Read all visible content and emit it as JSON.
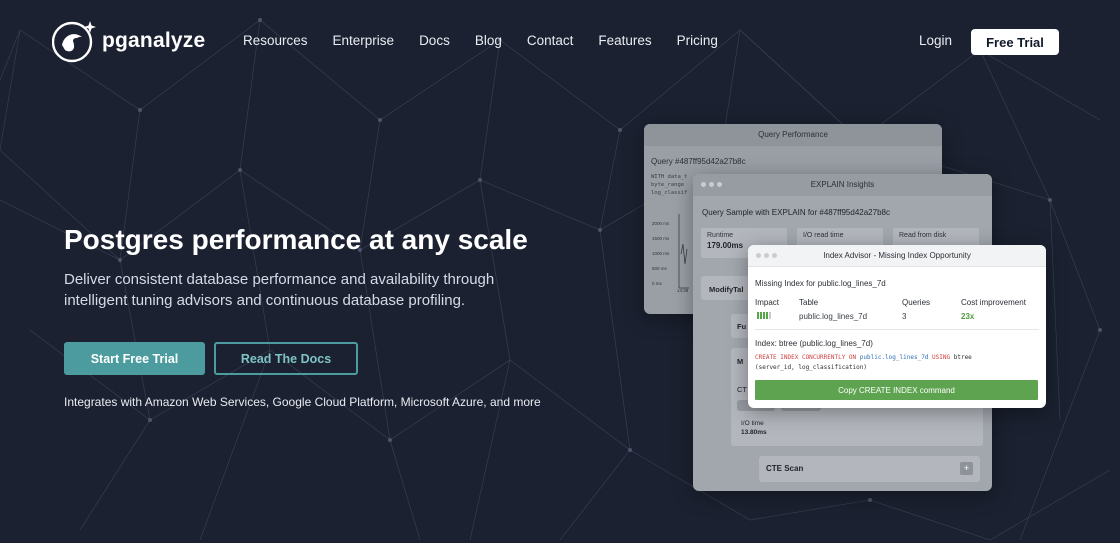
{
  "brand": {
    "name": "pganalyze"
  },
  "nav": {
    "items": [
      "Resources",
      "Enterprise",
      "Docs",
      "Blog",
      "Contact",
      "Features",
      "Pricing"
    ],
    "login": "Login",
    "free_trial": "Free Trial"
  },
  "hero": {
    "title": "Postgres performance at any scale",
    "subtitle": "Deliver consistent database performance and availability through intelligent tuning advisors and continuous database profiling.",
    "primary_cta": "Start Free Trial",
    "secondary_cta": "Read The Docs",
    "integrates": "Integrates with Amazon Web Services, Google Cloud Platform, Microsoft Azure, and more"
  },
  "query_performance": {
    "title": "Query Performance",
    "query": "Query #487ff95d42a27b8c",
    "code": [
      "WITH data_t",
      "byte_range",
      "log_classif"
    ],
    "y_ticks": [
      "2000 ms",
      "1500 ms",
      "1000 ms",
      "500 ms",
      "0 ms"
    ],
    "x_tick": "14:38"
  },
  "explain": {
    "title": "EXPLAIN Insights",
    "sample": "Query Sample with EXPLAIN for #487ff95d42a27b8c",
    "stats": [
      {
        "label": "Runtime",
        "value": "179.00ms"
      },
      {
        "label": "I/O read time",
        "value": ""
      },
      {
        "label": "Read from disk",
        "value": ""
      }
    ],
    "modify": "ModifyTal",
    "fu": "Fu",
    "m": "M",
    "ct": "CT",
    "io_label": "I/O time",
    "io_value": "13.80ms",
    "cte_scan": "CTE Scan",
    "plus": "+"
  },
  "index_advisor": {
    "title": "Index Advisor - Missing Index Opportunity",
    "missing": "Missing Index for public.log_lines_7d",
    "columns": {
      "impact": "Impact",
      "table": "Table",
      "queries": "Queries",
      "cost": "Cost improvement"
    },
    "impact_level": 0.8,
    "table": "public.log_lines_7d",
    "queries": "3",
    "cost_improvement": "23x",
    "index_title": "Index: btree (public.log_lines_7d)",
    "sql": {
      "kw1": "CREATE INDEX CONCURRENTLY ON",
      "table": "public.log_lines_7d",
      "kw2": "USING",
      "method": "btree",
      "cols": "(server_id, log_classification)"
    },
    "copy_button": "Copy CREATE INDEX command"
  },
  "colors": {
    "background": "#1b2130",
    "teal": "#4c9c9f",
    "green": "#5ea34f"
  }
}
